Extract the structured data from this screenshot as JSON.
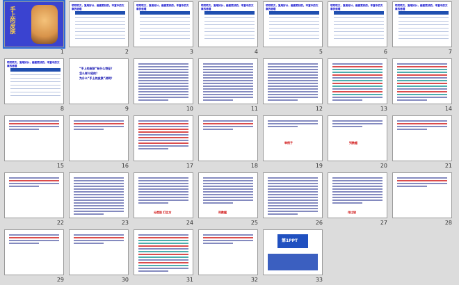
{
  "colors": {
    "accent": "#0000cc",
    "red": "#cc0000",
    "selection": "#2f6bd6"
  },
  "slides": [
    {
      "n": "1",
      "kind": "title",
      "title": "手上的皮肤"
    },
    {
      "n": "2",
      "kind": "table",
      "text": "咬咬咬文，复用好计，画面更好的。丰富中的文章的道理"
    },
    {
      "n": "3",
      "kind": "table",
      "text": "咬咬咬文，复用好计，画面更好的。丰富中的文章的道理"
    },
    {
      "n": "4",
      "kind": "table",
      "text": "咬咬咬文，复用好计，画面更好的。丰富中的文章的道理"
    },
    {
      "n": "5",
      "kind": "table",
      "text": "咬咬咬文，复用好计，画面更好的。丰富中的文章的道理"
    },
    {
      "n": "6",
      "kind": "table",
      "text": "咬咬咬文，复用好计，画面更好的。丰富中的文章的道理"
    },
    {
      "n": "7",
      "kind": "table",
      "text": "咬咬咬文，复用好计，画面更好的。丰富中的文章的道理"
    },
    {
      "n": "8",
      "kind": "table",
      "text": "咬咬咬文，复用好计，画面更好的。丰富中的文章的道理"
    },
    {
      "n": "9",
      "kind": "questions",
      "lines": [
        "“手上的皮肤”有什么特征？",
        "怎么样介绍的？",
        "为什么“手上的皮肤”讲明？"
      ]
    },
    {
      "n": "10",
      "kind": "text"
    },
    {
      "n": "11",
      "kind": "text"
    },
    {
      "n": "12",
      "kind": "text"
    },
    {
      "n": "13",
      "kind": "textmix"
    },
    {
      "n": "14",
      "kind": "textmix"
    },
    {
      "n": "15",
      "kind": "short"
    },
    {
      "n": "16",
      "kind": "short"
    },
    {
      "n": "17",
      "kind": "redtext"
    },
    {
      "n": "18",
      "kind": "short"
    },
    {
      "n": "19",
      "kind": "shortlabel",
      "label": "举例子"
    },
    {
      "n": "20",
      "kind": "shortlabel",
      "label": "列数据"
    },
    {
      "n": "21",
      "kind": "short"
    },
    {
      "n": "22",
      "kind": "short"
    },
    {
      "n": "23",
      "kind": "text"
    },
    {
      "n": "24",
      "kind": "textlabel",
      "label": "分类别  打比方"
    },
    {
      "n": "25",
      "kind": "textlabel",
      "label": "列数据"
    },
    {
      "n": "26",
      "kind": "text"
    },
    {
      "n": "27",
      "kind": "textlabel",
      "label": "作比较"
    },
    {
      "n": "28",
      "kind": "short"
    },
    {
      "n": "29",
      "kind": "short"
    },
    {
      "n": "30",
      "kind": "short"
    },
    {
      "n": "31",
      "kind": "textmix"
    },
    {
      "n": "32",
      "kind": "short"
    },
    {
      "n": "33",
      "kind": "ppt",
      "label": "第1PPT"
    }
  ]
}
